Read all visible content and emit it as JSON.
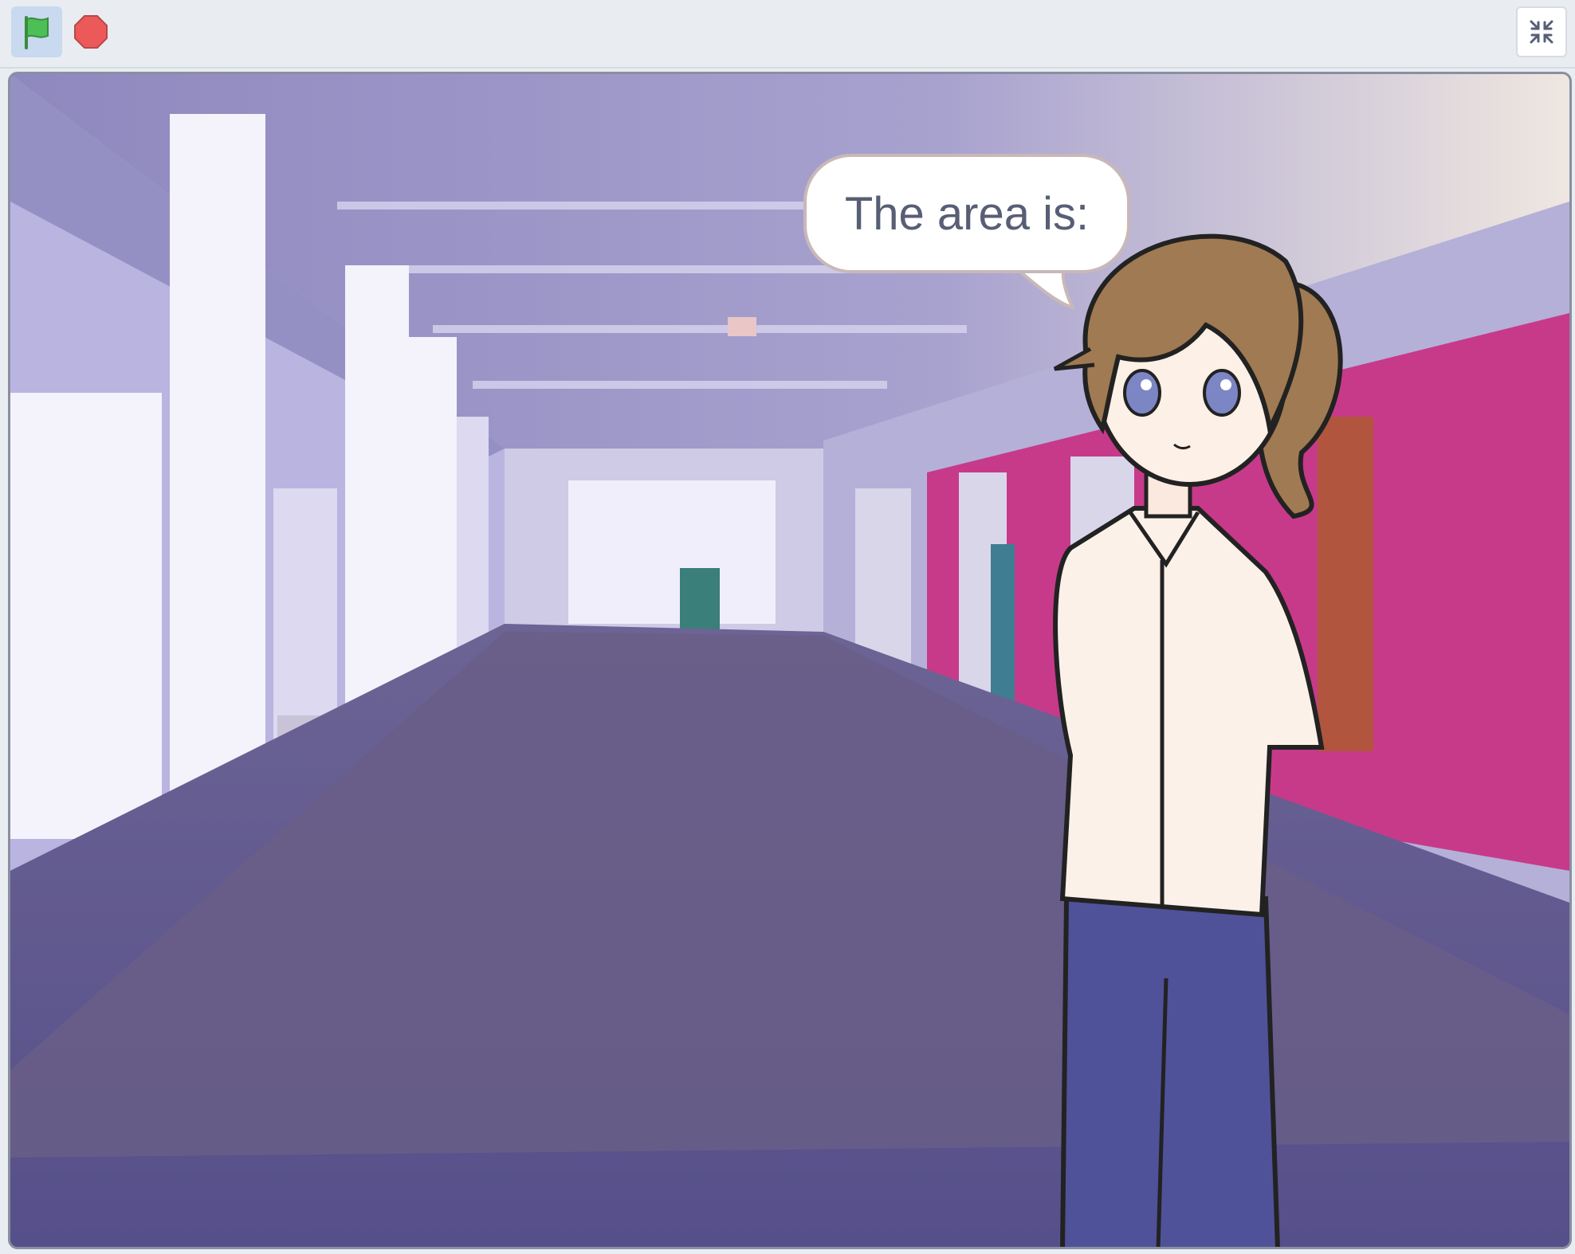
{
  "toolbar": {
    "green_flag_icon": "green-flag-icon",
    "stop_icon": "stop-sign-icon",
    "fullscreen_icon": "exit-fullscreen-icon"
  },
  "stage": {
    "speech_bubble": {
      "text": "The area is:"
    }
  },
  "colors": {
    "flag_green": "#4cbf56",
    "stop_red": "#ec5959",
    "bubble_text": "#575e75"
  }
}
